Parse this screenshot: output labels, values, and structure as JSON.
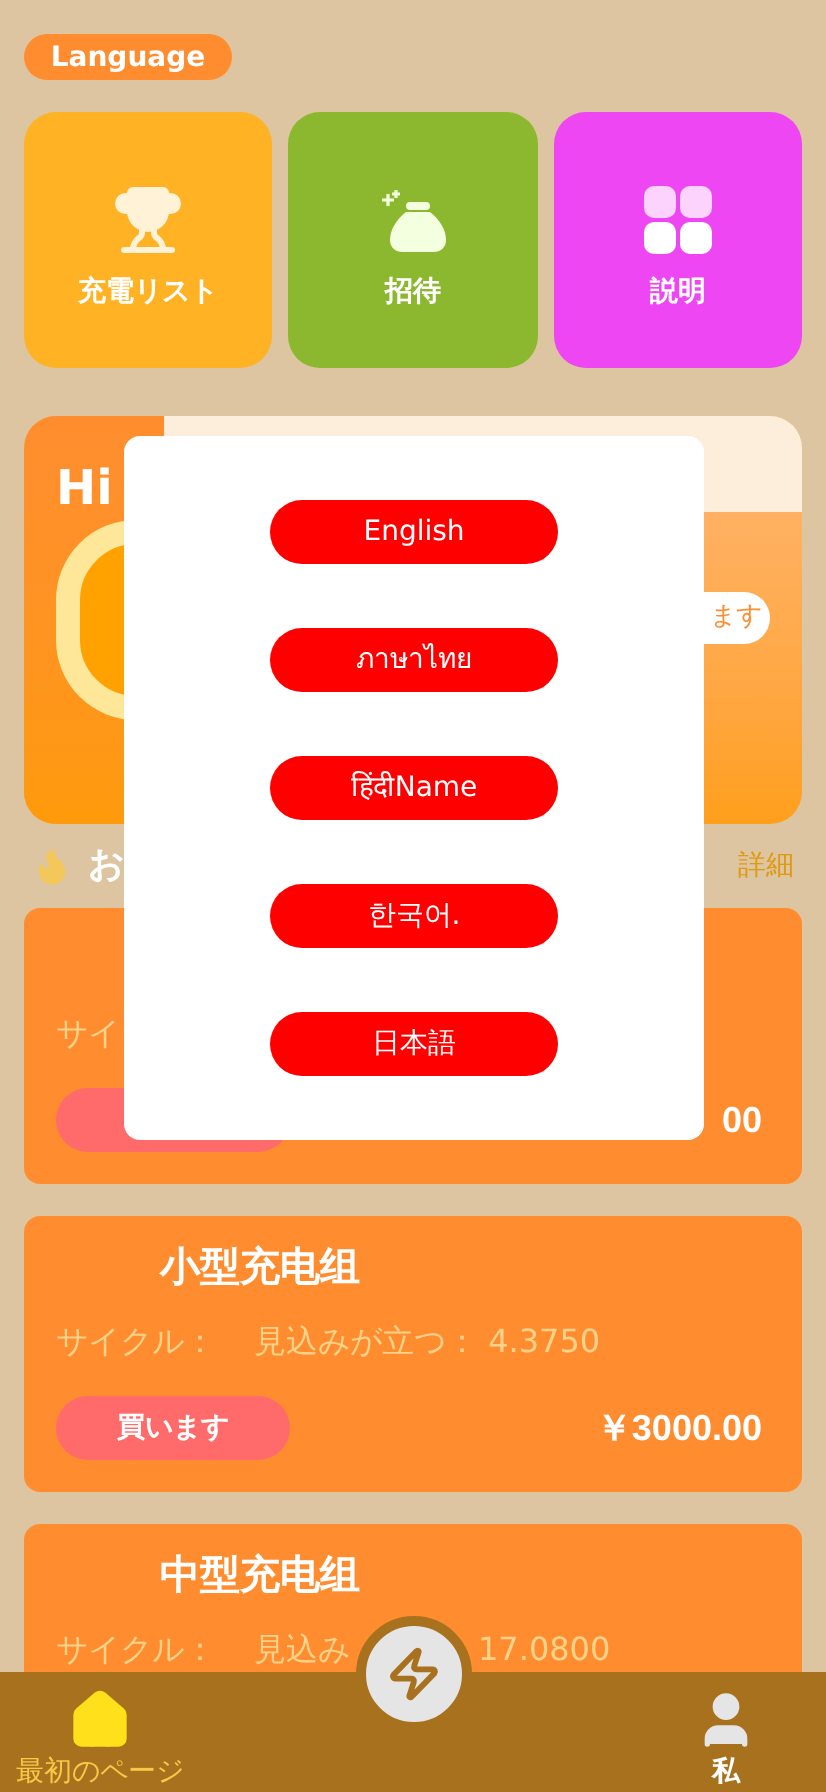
{
  "language_button": "Language",
  "tiles": [
    {
      "kind": "trophy",
      "label": "充電リスト",
      "color": "#ffb224"
    },
    {
      "kind": "bag",
      "label": "招待",
      "color": "#8bb82f"
    },
    {
      "kind": "grid",
      "label": "説明",
      "color": "#ee46f2"
    }
  ],
  "hero": {
    "greeting": "Hi",
    "button": "ます"
  },
  "section": {
    "title": "お",
    "link": "詳細"
  },
  "products": [
    {
      "cycle_label": "サイ",
      "price": "00"
    },
    {
      "title": "小型充电组",
      "cycle_label": "サイクル：",
      "expected": "見込みが立つ： 4.3750",
      "buy_button": "買います",
      "price": "￥3000.00"
    },
    {
      "title": "中型充电组",
      "cycle_label": "サイクル：",
      "expected": "見込み",
      "expected_value": "17.0800"
    }
  ],
  "languages": [
    "English",
    "ภาษาไทย",
    "हिंदीName",
    "한국어.",
    "日本語"
  ],
  "nav": [
    {
      "kind": "home",
      "label": "最初のページ",
      "selected": true
    },
    {
      "kind": "center"
    },
    {
      "kind": "user",
      "label": "私",
      "selected": false
    }
  ]
}
